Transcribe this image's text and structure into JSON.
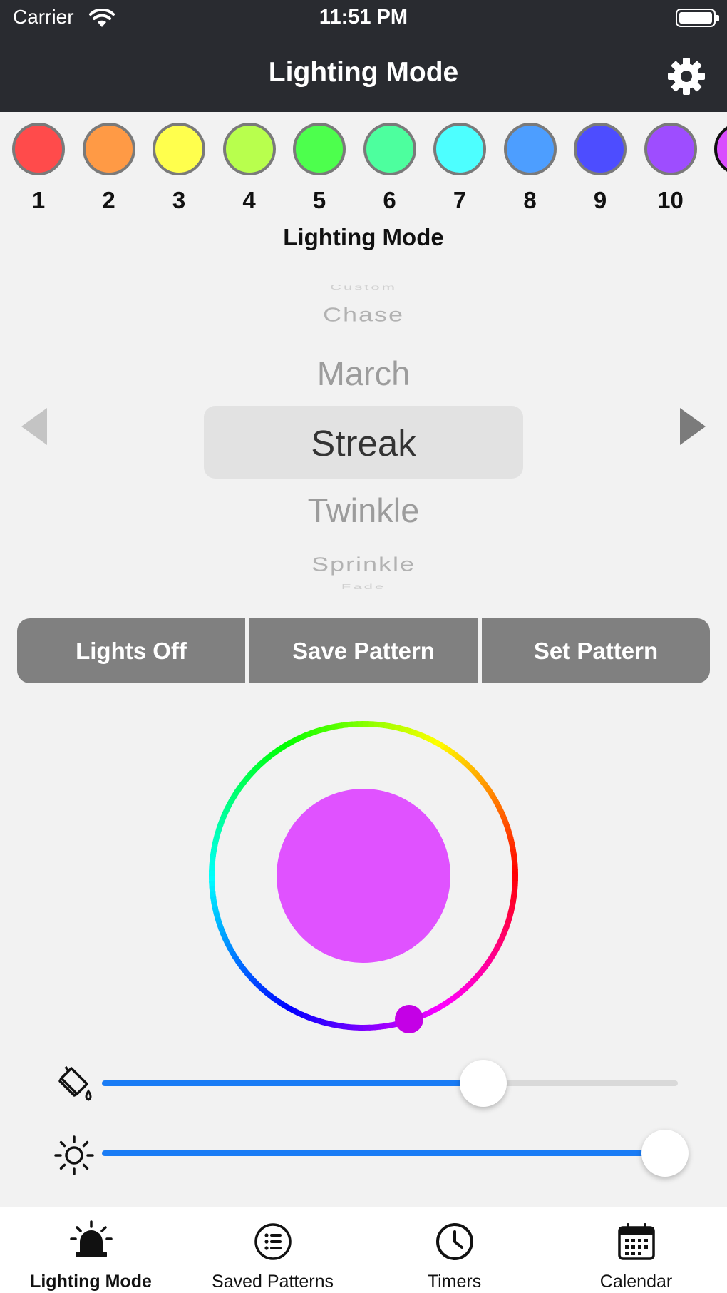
{
  "status": {
    "carrier": "Carrier",
    "time": "11:51 PM"
  },
  "nav": {
    "title": "Lighting Mode"
  },
  "swatches": [
    {
      "label": "1",
      "color": "#ff4b4b"
    },
    {
      "label": "2",
      "color": "#ff9a45"
    },
    {
      "label": "3",
      "color": "#ffff4d"
    },
    {
      "label": "4",
      "color": "#b8ff4d"
    },
    {
      "label": "5",
      "color": "#4dff4d"
    },
    {
      "label": "6",
      "color": "#4dff9e"
    },
    {
      "label": "7",
      "color": "#4dffff"
    },
    {
      "label": "8",
      "color": "#4d9eff"
    },
    {
      "label": "9",
      "color": "#4d4dff"
    },
    {
      "label": "10",
      "color": "#9e4dff"
    },
    {
      "label": "",
      "color": "#d94dff"
    }
  ],
  "section": {
    "title": "Lighting Mode"
  },
  "picker": {
    "items": [
      "Custom",
      "Chase",
      "March",
      "Streak",
      "Twinkle",
      "Sprinkle",
      "Fade"
    ],
    "selected": "Streak"
  },
  "buttons": {
    "lights_off": "Lights Off",
    "save_pattern": "Save Pattern",
    "set_pattern": "Set Pattern"
  },
  "color_wheel": {
    "selected_color": "#e052ff",
    "handle_color": "#c400e6"
  },
  "sliders": {
    "saturation": {
      "value": 0.67
    },
    "brightness": {
      "value": 1.0
    }
  },
  "tabs": [
    {
      "label": "Lighting Mode",
      "active": true
    },
    {
      "label": "Saved Patterns",
      "active": false
    },
    {
      "label": "Timers",
      "active": false
    },
    {
      "label": "Calendar",
      "active": false
    }
  ],
  "colors": {
    "accent": "#1a7cf5",
    "nav_bg": "#292b30",
    "button_bg": "#808080"
  }
}
